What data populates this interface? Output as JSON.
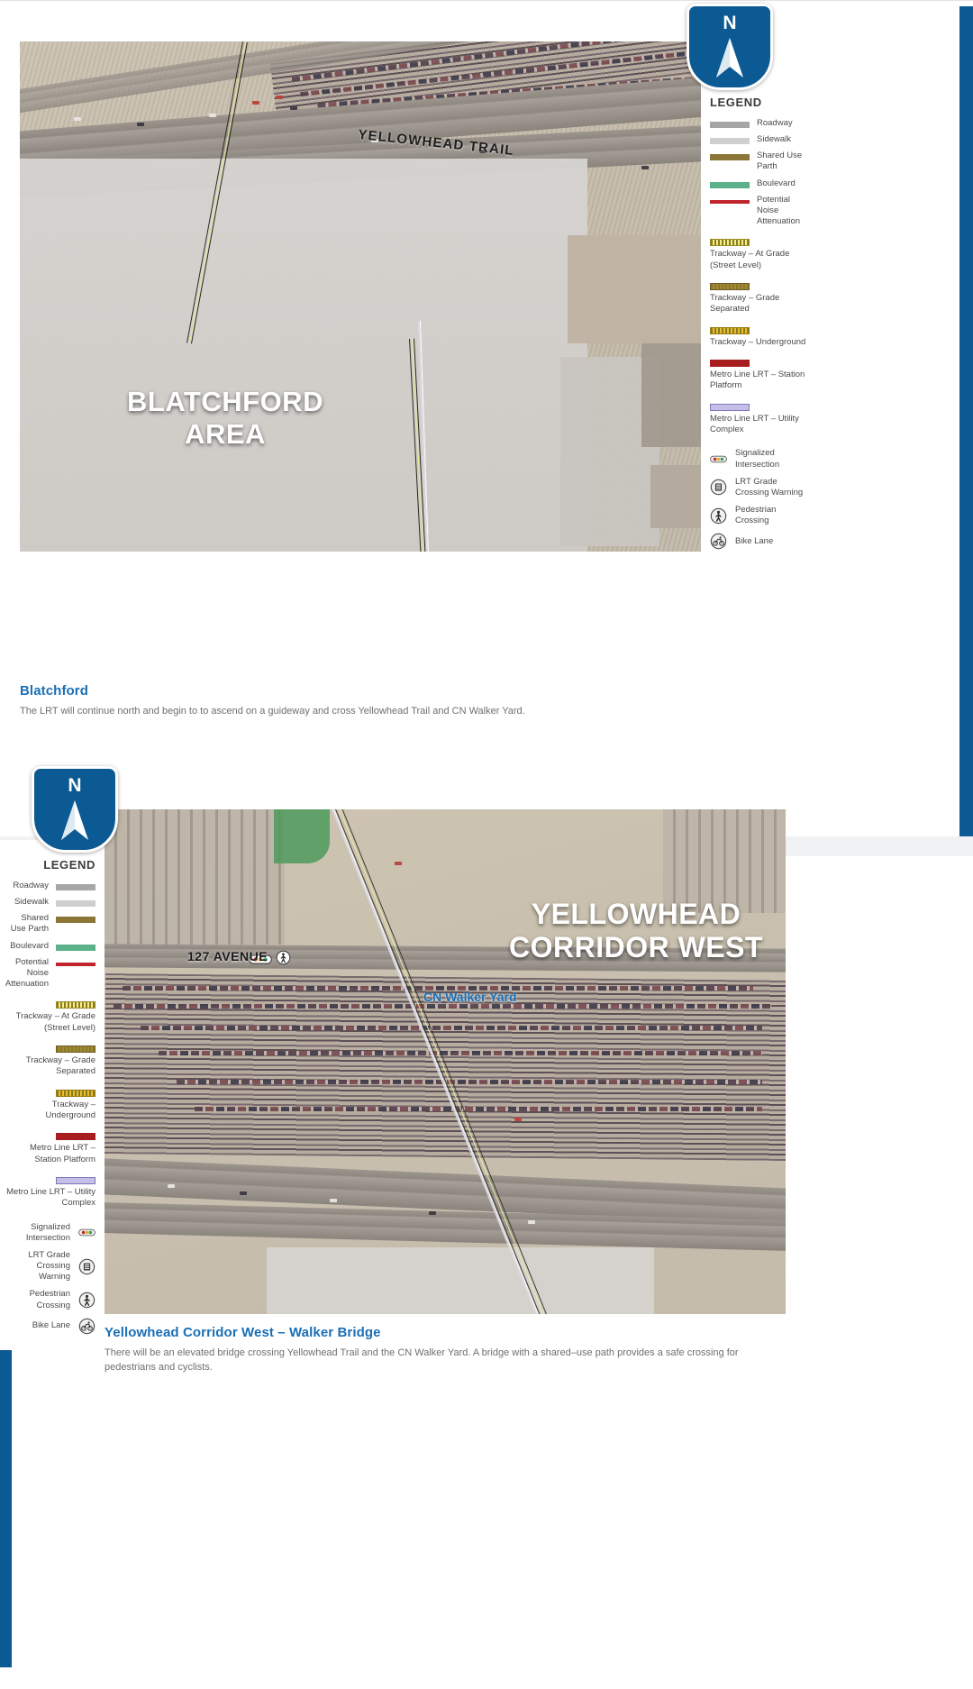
{
  "page": {
    "accent_blue": "#0b5a94",
    "caption_blue": "#1a6fb5"
  },
  "legend": {
    "title": "LEGEND",
    "line_items": [
      {
        "label": "Roadway",
        "color": "#a6a6a6",
        "swatch": "roadway-swatch"
      },
      {
        "label": "Sidewalk",
        "color": "#cfcfcf",
        "swatch": "sidewalk-swatch"
      },
      {
        "label": "Shared Use Parth",
        "color": "#8c7637",
        "swatch": "shared-use-path-swatch"
      },
      {
        "label": "Boulevard",
        "color": "#5cb08a",
        "swatch": "boulevard-swatch"
      },
      {
        "label": "Potential Noise Attenuation",
        "color": "#c0232a",
        "swatch": "noise-attenuation-swatch"
      }
    ],
    "stacked_items": [
      {
        "label": "Trackway – At Grade (Street Level)",
        "color": "#f4ef8c",
        "swatch": "trackway-at-grade-swatch"
      },
      {
        "label": "Trackway – Grade Separated",
        "color": "#a28740",
        "swatch": "trackway-grade-separated-swatch"
      },
      {
        "label": "Trackway – Underground",
        "color": "#e9bc2c",
        "swatch": "trackway-underground-swatch"
      },
      {
        "label": "Metro Line LRT – Station Platform",
        "color": "#a81e20",
        "swatch": "station-platform-swatch"
      },
      {
        "label": "Metro Line LRT – Utility Complex",
        "color": "#c3bfe6",
        "swatch": "utility-complex-swatch"
      }
    ],
    "icon_items": [
      {
        "label": "Signalized Intersection",
        "icon": "traffic-signal-icon"
      },
      {
        "label": "LRT Grade Crossing Warning",
        "icon": "lrt-grade-crossing-icon"
      },
      {
        "label": "Pedestrian Crossing",
        "icon": "pedestrian-crossing-icon"
      },
      {
        "label": "Bike Lane",
        "icon": "bike-lane-icon"
      }
    ]
  },
  "north_arrow": {
    "letter": "N",
    "name": "north-arrow"
  },
  "section_top": {
    "map_overlay_title": "BLATCHFORD\nAREA",
    "map_overlay_title_line1": "BLATCHFORD",
    "map_overlay_title_line2": "AREA",
    "road_label": "YELLOWHEAD TRAIL",
    "caption_title": "Blatchford",
    "caption_body": "The LRT will continue north and begin to to ascend on a guideway and cross Yellowhead Trail and CN Walker Yard."
  },
  "section_bottom": {
    "map_overlay_title_line1": "YELLOWHEAD",
    "map_overlay_title_line2": "CORRIDOR WEST",
    "avenue_label": "127 AVENUE",
    "yard_label": "CN Walker Yard",
    "caption_title": "Yellowhead Corridor West – Walker Bridge",
    "caption_body": "There will be an elevated bridge crossing Yellowhead Trail and the CN Walker Yard. A bridge with a shared–use path provides a safe crossing for pedestrians and cyclists."
  }
}
